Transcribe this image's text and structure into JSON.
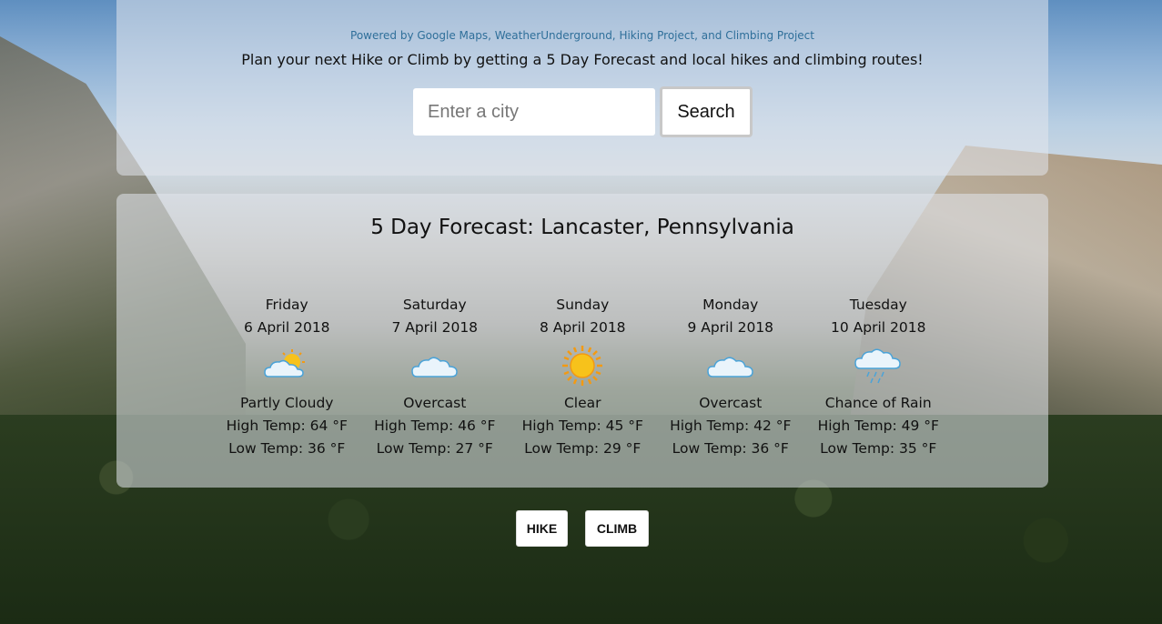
{
  "header": {
    "powered_by": "Powered by Google Maps, WeatherUnderground, Hiking Project, and Climbing Project",
    "tagline": "Plan your next Hike or Climb by getting a 5 Day Forecast and local hikes and climbing routes!"
  },
  "search": {
    "placeholder": "Enter a city",
    "value": "",
    "button_label": "Search"
  },
  "forecast": {
    "title": "5 Day Forecast: Lancaster, Pennsylvania",
    "days": [
      {
        "day": "Friday",
        "date": "6 April 2018",
        "icon": "partly-cloudy-icon",
        "condition": "Partly Cloudy",
        "high": "High Temp: 64 °F",
        "low": "Low Temp: 36 °F"
      },
      {
        "day": "Saturday",
        "date": "7 April 2018",
        "icon": "overcast-icon",
        "condition": "Overcast",
        "high": "High Temp: 46 °F",
        "low": "Low Temp: 27 °F"
      },
      {
        "day": "Sunday",
        "date": "8 April 2018",
        "icon": "clear-sun-icon",
        "condition": "Clear",
        "high": "High Temp: 45 °F",
        "low": "Low Temp: 29 °F"
      },
      {
        "day": "Monday",
        "date": "9 April 2018",
        "icon": "overcast-icon",
        "condition": "Overcast",
        "high": "High Temp: 42 °F",
        "low": "Low Temp: 36 °F"
      },
      {
        "day": "Tuesday",
        "date": "10 April 2018",
        "icon": "chance-of-rain-icon",
        "condition": "Chance of Rain",
        "high": "High Temp: 49 °F",
        "low": "Low Temp: 35 °F"
      }
    ]
  },
  "actions": {
    "hike_label": "HIKE",
    "climb_label": "CLIMB"
  },
  "colors": {
    "powered_link": "#2f6f9a",
    "panel": "rgba(225,230,236,0.55)",
    "sun": "#f7c21b",
    "cloud": "#eaf4fb"
  }
}
